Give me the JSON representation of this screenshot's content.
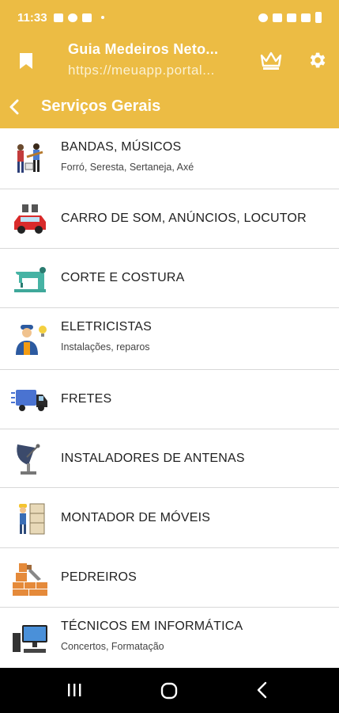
{
  "status": {
    "time": "11:33"
  },
  "app": {
    "title": "Guia Medeiros Neto...",
    "url": "https://meuapp.portal..."
  },
  "toolbar": {
    "title": "Serviços Gerais"
  },
  "items": [
    {
      "title": "BANDAS, MÚSICOS",
      "subtitle": "Forró, Seresta, Sertaneja, Axé",
      "icon": "musicians-icon"
    },
    {
      "title": "CARRO DE SOM, ANÚNCIOS, LOCUTOR",
      "subtitle": "",
      "icon": "sound-car-icon"
    },
    {
      "title": "CORTE E COSTURA",
      "subtitle": "",
      "icon": "sewing-machine-icon"
    },
    {
      "title": "ELETRICISTAS",
      "subtitle": "Instalações, reparos",
      "icon": "electrician-icon"
    },
    {
      "title": "FRETES",
      "subtitle": "",
      "icon": "truck-icon"
    },
    {
      "title": "INSTALADORES DE ANTENAS",
      "subtitle": "",
      "icon": "satellite-antenna-icon"
    },
    {
      "title": "MONTADOR DE MÓVEIS",
      "subtitle": "",
      "icon": "furniture-assembler-icon"
    },
    {
      "title": "PEDREIROS",
      "subtitle": "",
      "icon": "bricks-icon"
    },
    {
      "title": "TÉCNICOS EM INFORMÁTICA",
      "subtitle": "Concertos, Formatação",
      "icon": "computer-icon"
    }
  ],
  "colors": {
    "accent": "#ecbc44",
    "divider": "#d8d8d8",
    "nav_bar": "#000000"
  }
}
